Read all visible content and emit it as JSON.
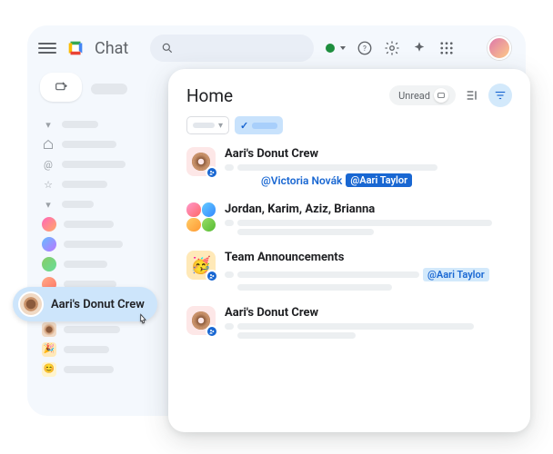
{
  "brand": {
    "label": "Chat"
  },
  "unread": {
    "label": "Unread"
  },
  "panel": {
    "title": "Home"
  },
  "hover": {
    "label": "Aari's Donut Crew"
  },
  "mentions": {
    "victoria": "@Victoria Novák",
    "aari": "@Aari Taylor"
  },
  "conversations": [
    {
      "title": "Aari's Donut Crew"
    },
    {
      "title": "Jordan, Karim, Aziz, Brianna"
    },
    {
      "title": "Team Announcements"
    },
    {
      "title": "Aari's Donut Crew"
    }
  ]
}
